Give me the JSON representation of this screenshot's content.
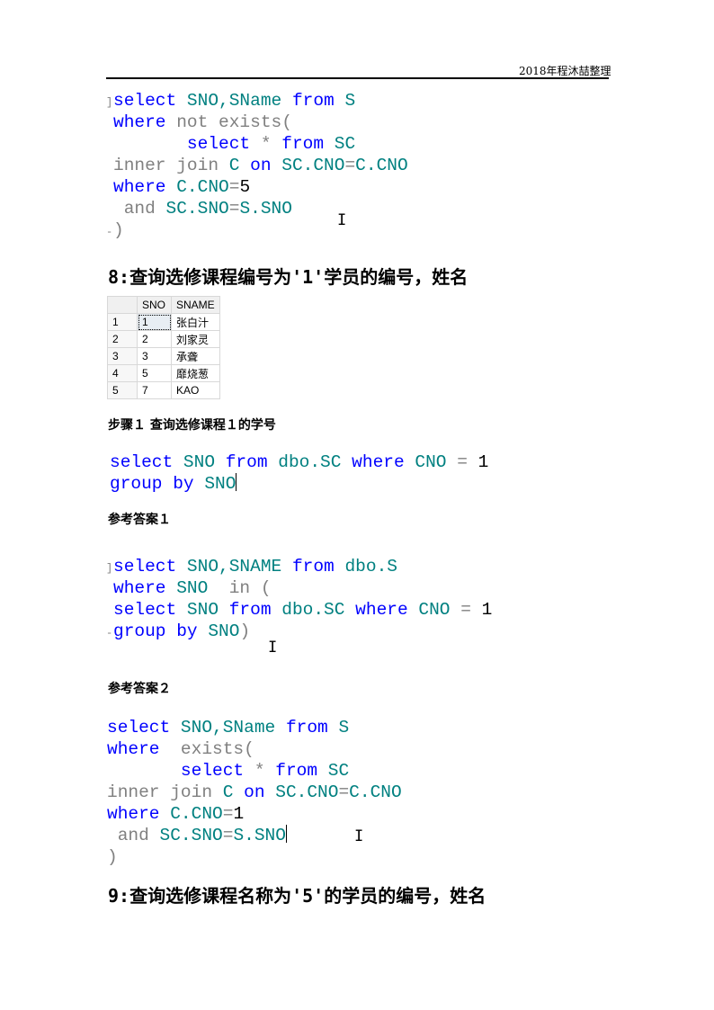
{
  "header": {
    "text": "2018年程沐喆整理"
  },
  "block1": {
    "lines": [
      [
        {
          "t": "select",
          "c": "kw"
        },
        {
          "t": " SNO,SName ",
          "c": "id"
        },
        {
          "t": "from",
          "c": "kw"
        },
        {
          "t": " S",
          "c": "id"
        }
      ],
      [
        {
          "t": "where",
          "c": "kw"
        },
        {
          "t": " not exists(",
          "c": "gr"
        }
      ],
      [
        {
          "t": "       ",
          "c": "gr"
        },
        {
          "t": "select",
          "c": "kw"
        },
        {
          "t": " * ",
          "c": "gr"
        },
        {
          "t": "from",
          "c": "kw"
        },
        {
          "t": " SC",
          "c": "id"
        }
      ],
      [
        {
          "t": "inner join ",
          "c": "gr"
        },
        {
          "t": "C ",
          "c": "id"
        },
        {
          "t": "on",
          "c": "kw"
        },
        {
          "t": " SC.CNO",
          "c": "id"
        },
        {
          "t": "=",
          "c": "gr"
        },
        {
          "t": "C.CNO",
          "c": "id"
        }
      ],
      [
        {
          "t": "where",
          "c": "kw"
        },
        {
          "t": " C.CNO",
          "c": "id"
        },
        {
          "t": "=",
          "c": "gr"
        },
        {
          "t": "5",
          "c": "num"
        }
      ],
      [
        {
          "t": " and ",
          "c": "gr"
        },
        {
          "t": "SC.SNO",
          "c": "id"
        },
        {
          "t": "=",
          "c": "gr"
        },
        {
          "t": "S.SNO",
          "c": "id"
        }
      ],
      [
        {
          "t": ")",
          "c": "gr"
        }
      ]
    ]
  },
  "q8": {
    "title": "8:查询选修课程编号为'1'学员的编号，姓名"
  },
  "result_grid": {
    "columns": [
      "",
      "SNO",
      "SNAME"
    ],
    "rows": [
      {
        "n": "1",
        "sno": "1",
        "sname": "张白汁"
      },
      {
        "n": "2",
        "sno": "2",
        "sname": "刘家灵"
      },
      {
        "n": "3",
        "sno": "3",
        "sname": "承聋"
      },
      {
        "n": "4",
        "sno": "5",
        "sname": "靡烧葱"
      },
      {
        "n": "5",
        "sno": "7",
        "sname": "KAO"
      }
    ]
  },
  "step1": {
    "label": "步骤１ 查询选修课程１的学号"
  },
  "block2": {
    "lines": [
      [
        {
          "t": "select",
          "c": "kw"
        },
        {
          "t": " SNO ",
          "c": "id"
        },
        {
          "t": "from",
          "c": "kw"
        },
        {
          "t": " dbo.SC ",
          "c": "id"
        },
        {
          "t": "where",
          "c": "kw"
        },
        {
          "t": " CNO ",
          "c": "id"
        },
        {
          "t": "= ",
          "c": "gr"
        },
        {
          "t": "1",
          "c": "num"
        }
      ],
      [
        {
          "t": "group by",
          "c": "kw"
        },
        {
          "t": " SNO",
          "c": "id"
        }
      ]
    ]
  },
  "answer1": {
    "label": "参考答案１"
  },
  "block3": {
    "lines": [
      [
        {
          "t": "select",
          "c": "kw"
        },
        {
          "t": " SNO,SNAME ",
          "c": "id"
        },
        {
          "t": "from",
          "c": "kw"
        },
        {
          "t": " dbo.S",
          "c": "id"
        }
      ],
      [
        {
          "t": "where",
          "c": "kw"
        },
        {
          "t": " SNO  ",
          "c": "id"
        },
        {
          "t": "in (",
          "c": "gr"
        }
      ],
      [
        {
          "t": "select",
          "c": "kw"
        },
        {
          "t": " SNO ",
          "c": "id"
        },
        {
          "t": "from",
          "c": "kw"
        },
        {
          "t": " dbo.SC ",
          "c": "id"
        },
        {
          "t": "where",
          "c": "kw"
        },
        {
          "t": " CNO ",
          "c": "id"
        },
        {
          "t": "= ",
          "c": "gr"
        },
        {
          "t": "1",
          "c": "num"
        }
      ],
      [
        {
          "t": "group by",
          "c": "kw"
        },
        {
          "t": " SNO",
          "c": "id"
        },
        {
          "t": ")",
          "c": "gr"
        }
      ]
    ]
  },
  "answer2": {
    "label": "参考答案２"
  },
  "block4": {
    "lines": [
      [
        {
          "t": "select",
          "c": "kw"
        },
        {
          "t": " SNO,SName ",
          "c": "id"
        },
        {
          "t": "from",
          "c": "kw"
        },
        {
          "t": " S",
          "c": "id"
        }
      ],
      [
        {
          "t": "where",
          "c": "kw"
        },
        {
          "t": "  exists(",
          "c": "gr"
        }
      ],
      [
        {
          "t": "       ",
          "c": "gr"
        },
        {
          "t": "select",
          "c": "kw"
        },
        {
          "t": " * ",
          "c": "gr"
        },
        {
          "t": "from",
          "c": "kw"
        },
        {
          "t": " SC",
          "c": "id"
        }
      ],
      [
        {
          "t": "inner join ",
          "c": "gr"
        },
        {
          "t": "C ",
          "c": "id"
        },
        {
          "t": "on",
          "c": "kw"
        },
        {
          "t": " SC.CNO",
          "c": "id"
        },
        {
          "t": "=",
          "c": "gr"
        },
        {
          "t": "C.CNO",
          "c": "id"
        }
      ],
      [
        {
          "t": "where",
          "c": "kw"
        },
        {
          "t": " C.CNO",
          "c": "id"
        },
        {
          "t": "=",
          "c": "gr"
        },
        {
          "t": "1",
          "c": "num"
        }
      ],
      [
        {
          "t": " and ",
          "c": "gr"
        },
        {
          "t": "SC.SNO",
          "c": "id"
        },
        {
          "t": "=",
          "c": "gr"
        },
        {
          "t": "S.SNO",
          "c": "id"
        }
      ],
      [
        {
          "t": ")",
          "c": "gr"
        }
      ]
    ]
  },
  "q9": {
    "title": "9:查询选修课程名称为'5'的学员的编号，姓名"
  },
  "icons": {
    "text_cursor": "I-beam",
    "outline_open": "]",
    "outline_close": "-"
  }
}
